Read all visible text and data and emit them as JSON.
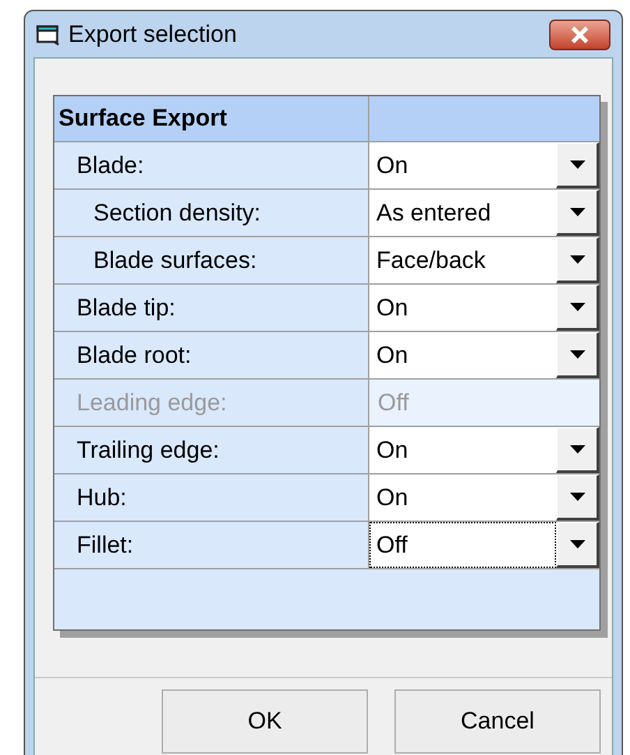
{
  "window": {
    "title": "Export selection"
  },
  "grid": {
    "header": "Surface Export",
    "rows": [
      {
        "label": "Blade:",
        "value": "On",
        "disabled": false,
        "focused": false,
        "children": [
          {
            "label": "Section density:",
            "value": "As entered",
            "disabled": false,
            "focused": false
          },
          {
            "label": "Blade surfaces:",
            "value": "Face/back",
            "disabled": false,
            "focused": false
          }
        ]
      },
      {
        "label": "Blade tip:",
        "value": "On",
        "disabled": false,
        "focused": false
      },
      {
        "label": "Blade root:",
        "value": "On",
        "disabled": false,
        "focused": false
      },
      {
        "label": "Leading edge:",
        "value": "Off",
        "disabled": true
      },
      {
        "label": "Trailing edge:",
        "value": "On",
        "disabled": false,
        "focused": false
      },
      {
        "label": "Hub:",
        "value": "On",
        "disabled": false,
        "focused": false
      },
      {
        "label": "Fillet:",
        "value": "Off",
        "disabled": false,
        "focused": true
      }
    ]
  },
  "buttons": [
    "OK",
    "Cancel"
  ]
}
